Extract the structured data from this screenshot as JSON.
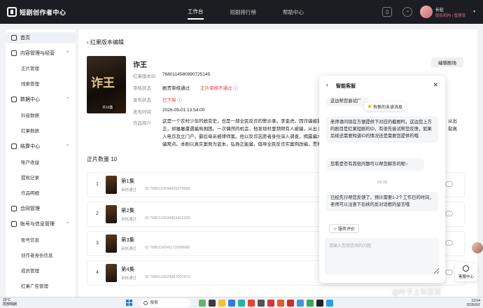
{
  "topbar": {
    "logo_text": "短剧创作者中心",
    "nav": [
      "工作台",
      "短剧排行榜",
      "帮助中心"
    ],
    "active_nav": "工作台",
    "user_name": "长征",
    "user_org": "版权机构 | 管理员"
  },
  "sidebar": {
    "home": "首页",
    "groups": [
      {
        "label": "内容管理与经营",
        "icon": "folder-icon",
        "subs": [
          "正片管理",
          "线索管理"
        ]
      },
      {
        "label": "数据中心",
        "icon": "chart-icon",
        "subs": [
          "抖音数据",
          "红果数据"
        ]
      },
      {
        "label": "结算中心",
        "icon": "wallet-icon",
        "subs": [
          "账户收益",
          "提现记录",
          "作品明细"
        ]
      },
      {
        "label": "合同管理",
        "icon": "contract-icon",
        "subs": []
      },
      {
        "label": "账号与信息管理",
        "icon": "account-icon",
        "subs": [
          "账号信息",
          "创作者身份信息",
          "成员管理",
          "红果广告管理"
        ]
      }
    ]
  },
  "main": {
    "back_title": "红果版本编辑",
    "cover_title": "诈王",
    "cover_tag": "共10集",
    "title": "诈王",
    "edit_button": "编辑剧场",
    "info": {
      "id_label": "红果版本ID",
      "id_value": "7680114580990725145",
      "review_label": "审核状态",
      "review_value": "剧责审核通过",
      "review_warn": "正片审核不通过",
      "publish_label": "发布状态",
      "publish_value": "已下架",
      "time_label": "发布时间",
      "time_value": "2026-09-01 13:54:00",
      "intro_label": "作品简介",
      "intro_value": "这是一个农村少年的蜕变史，也是一部全民反诈的警示录。李金虎，因诈骗被捕入狱，出狱后决心改邪归正，却屡屡遭遇骗局围困。一次偶然的机会，他发现村里频频有人被骗，从出 围闸落被嘱光折磨，刺拉入电诈及立门户。最后母亲被律师案。他以反诈志愿者身份深入调查，揭露骗术。最终与警方合作捣毁诈骗窝点。本剧以真实案例为蓝本，弘扬正能量，倡导全民反诈实案例改编，贯彻《反电信网络诈骗法》，以电影级质感揭示杀猪盘、裸聊敲诈等",
      "intro_right_1": "从出",
      "intro_right_2": "裂真"
    },
    "count_title": "正片数量 10",
    "episodes": [
      {
        "num": "1",
        "name": "第1集",
        "status": "审核通过",
        "id": "ID 7680116544065379585"
      },
      {
        "num": "2",
        "name": "第2集",
        "status": "审核通过",
        "id": "ID 7680116534802402329"
      },
      {
        "num": "3",
        "name": "第3集",
        "status": "审核通过",
        "id": "ID 7680116541172008985"
      },
      {
        "num": "4",
        "name": "第4集",
        "status": "审核通过",
        "id": "ID 7680116524887007673"
      }
    ]
  },
  "chat": {
    "title": "智能客服",
    "pill": "有新的未读消息",
    "msg_1": "这边帮您尝试厂",
    "msg_2": "老师请问现在方便提供下对应的截图吗，这边您上方的剧目是红果短剧的ID，有很先尝试帮您反馈，如果后续还需要知道ID的情况还是需要您提供的哦",
    "msg_3": "您看是否有其他问题可以帮您解答的呢~",
    "time": "09:39",
    "msg_4": "已经先行帮您反馈了，预计需要1-2个工作日的时间，老师可以注意下后续的反对话框的留言哦",
    "rate_button": "☆ 服务评价",
    "input_placeholder": "请输入您想咨询的问题"
  },
  "floating": {
    "service_label": "客服中心"
  },
  "taskbar": {
    "temp": "25°C",
    "weather": "局部晴朗",
    "search": "搜索",
    "clock_time": "13:54",
    "clock_date": "2026/9/2"
  },
  "watermark": "@叶子上车百货",
  "colors": {
    "accent_red": "#e23b3b",
    "topbar_bg": "#1c1d22",
    "org_pink": "#d76c8c"
  }
}
